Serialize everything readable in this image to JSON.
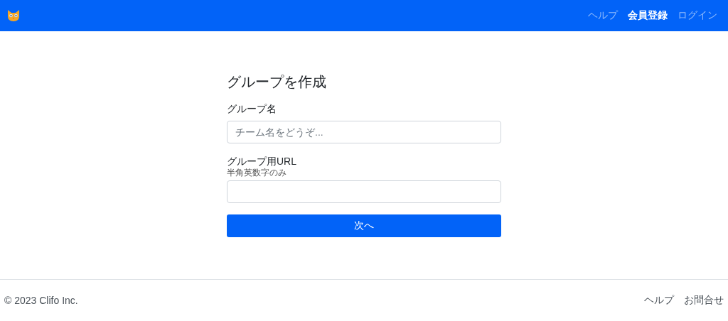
{
  "navbar": {
    "links": [
      {
        "label": "ヘルプ",
        "selected": false
      },
      {
        "label": "会員登録",
        "selected": true
      },
      {
        "label": "ログイン",
        "selected": false
      }
    ]
  },
  "form": {
    "title": "グループを作成",
    "fields": [
      {
        "label": "グループ名",
        "placeholder": "チーム名をどうぞ..."
      },
      {
        "label": "グループ用URL",
        "hint": "半角英数字のみ"
      }
    ],
    "submit": "次へ"
  },
  "footer": {
    "copyright": "© 2023 Clifo Inc.",
    "links": [
      "ヘルプ",
      "お問合せ"
    ]
  }
}
